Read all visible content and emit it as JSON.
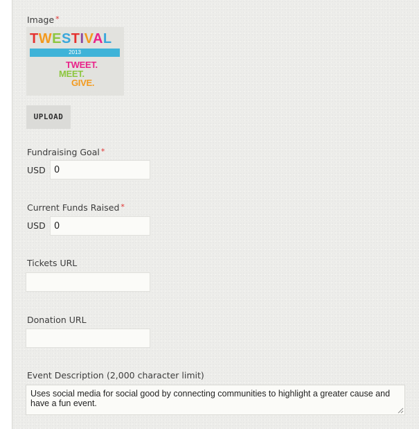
{
  "image_field": {
    "label": "Image",
    "required_mark": "*",
    "logo": {
      "letters": [
        {
          "char": "T",
          "color": "#e5312f"
        },
        {
          "char": "W",
          "color": "#f39a1e"
        },
        {
          "char": "E",
          "color": "#8cc63e"
        },
        {
          "char": "S",
          "color": "#3aa7db"
        },
        {
          "char": "T",
          "color": "#e5312f"
        },
        {
          "char": "I",
          "color": "#8e4a9e"
        },
        {
          "char": "V",
          "color": "#f39a1e"
        },
        {
          "char": "A",
          "color": "#e9238a"
        },
        {
          "char": "L",
          "color": "#3aa7db"
        }
      ],
      "year": "2013",
      "tagline": [
        {
          "text": "TWEET.",
          "color": "#e9238a"
        },
        {
          "text": "MEET.",
          "color": "#8cc63e"
        },
        {
          "text": "GIVE.",
          "color": "#f39a1e"
        }
      ]
    },
    "upload_label": "UPLOAD"
  },
  "fundraising_goal": {
    "label": "Fundraising Goal",
    "required_mark": "*",
    "currency": "USD",
    "value": "0"
  },
  "current_funds": {
    "label": "Current Funds Raised",
    "required_mark": "*",
    "currency": "USD",
    "value": "0"
  },
  "tickets_url": {
    "label": "Tickets URL",
    "value": ""
  },
  "donation_url": {
    "label": "Donation URL",
    "value": ""
  },
  "event_description": {
    "label": "Event Description (2,000 character limit)",
    "value": "Uses social media for social good by connecting communities to highlight a greater cause and have a fun event."
  }
}
